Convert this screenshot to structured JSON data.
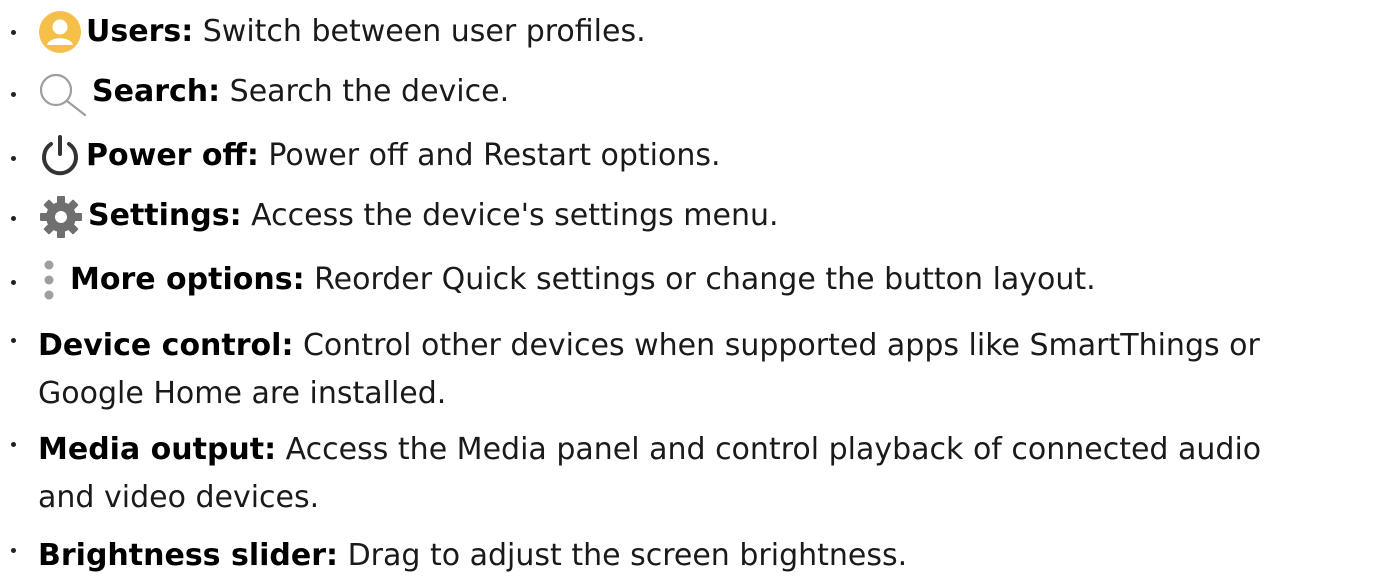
{
  "items": [
    {
      "icon": "user-icon",
      "term": "Users",
      "sep": ":",
      "desc": " Switch between user profiles."
    },
    {
      "icon": "search-icon",
      "term": "Search",
      "sep": ":",
      "desc": " Search the device."
    },
    {
      "icon": "power-icon",
      "term": "Power off",
      "sep": ":",
      "desc": " Power off and Restart options."
    },
    {
      "icon": "gear-icon",
      "term": "Settings",
      "sep": ":",
      "desc": " Access the device's settings menu."
    },
    {
      "icon": "more-vertical-icon",
      "term": "More options",
      "sep": ":",
      "desc": " Reorder Quick settings or change the button layout."
    },
    {
      "term": "Device control",
      "sep": ":",
      "desc": " Control other devices when supported apps like SmartThings or",
      "desc2": "Google Home are installed."
    },
    {
      "term": "Media output",
      "sep": ":",
      "desc": " Access the Media panel and control playback of connected audio",
      "desc2": "and video devices."
    },
    {
      "term": "Brightness slider",
      "sep": ":",
      "desc": " Drag to adjust the screen brightness."
    }
  ],
  "colors": {
    "user_icon": "#F5C04A",
    "search_icon": "#9E9E9E",
    "power_icon": "#333333",
    "gear_icon": "#6F6F6F",
    "more_icon": "#9E9E9E"
  }
}
